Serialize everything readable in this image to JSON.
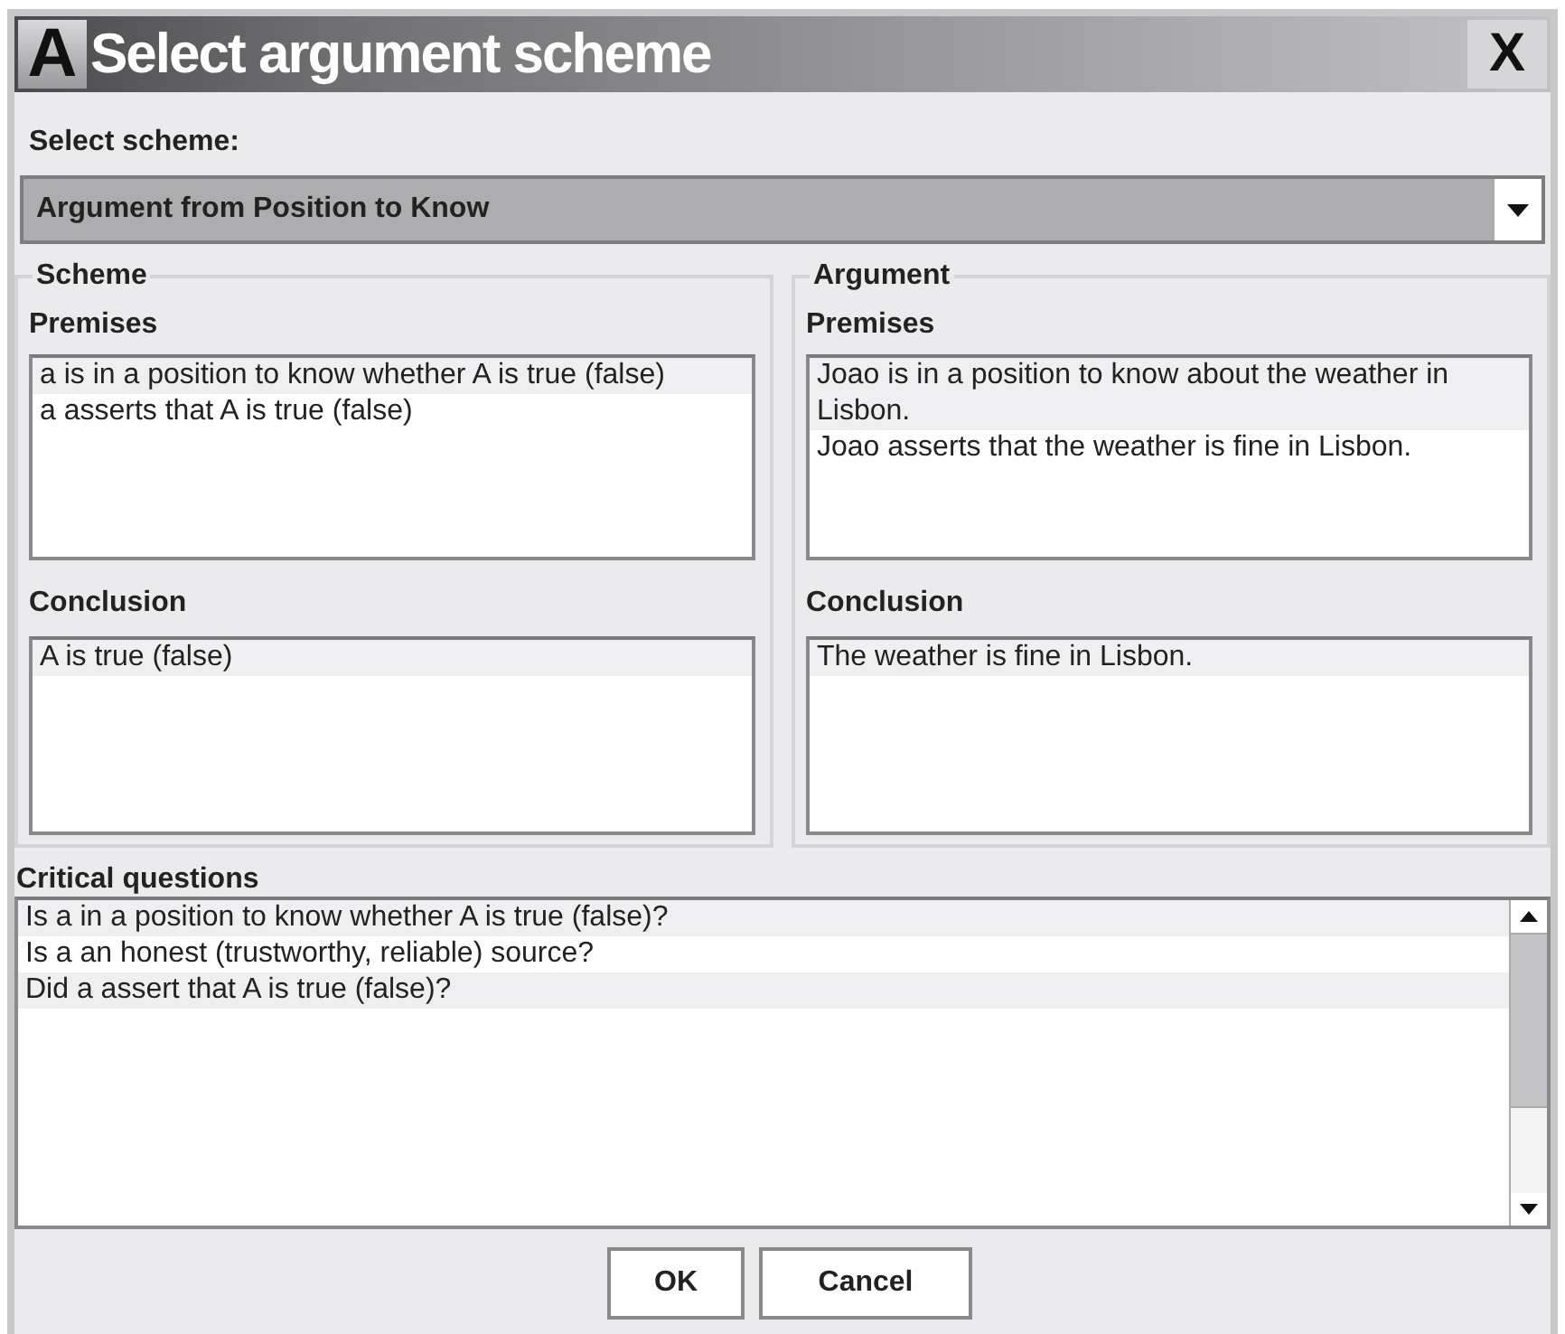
{
  "window": {
    "logo": "A",
    "title": "Select argument scheme",
    "close": "X"
  },
  "scheme_select": {
    "label": "Select scheme:",
    "value": "Argument from Position to Know"
  },
  "groups": [
    {
      "title": "Scheme",
      "premises_label": "Premises",
      "premises": [
        "a is in a position to know whether A is true (false)",
        "a asserts that A is true (false)"
      ],
      "conclusion_label": "Conclusion",
      "conclusion": [
        "A is true (false)"
      ]
    },
    {
      "title": "Argument",
      "premises_label": "Premises",
      "premises": [
        "Joao is in a position to know about the weather in Lisbon.",
        "Joao asserts that the weather is fine in Lisbon."
      ],
      "conclusion_label": "Conclusion",
      "conclusion": [
        "The weather is fine in Lisbon."
      ]
    }
  ],
  "critical_questions": {
    "label": "Critical questions",
    "items": [
      "Is a in a position to know whether A is true (false)?",
      "Is a an honest (trustworthy, reliable) source?",
      "Did a assert that A is true (false)?"
    ]
  },
  "buttons": [
    "OK",
    "Cancel"
  ]
}
